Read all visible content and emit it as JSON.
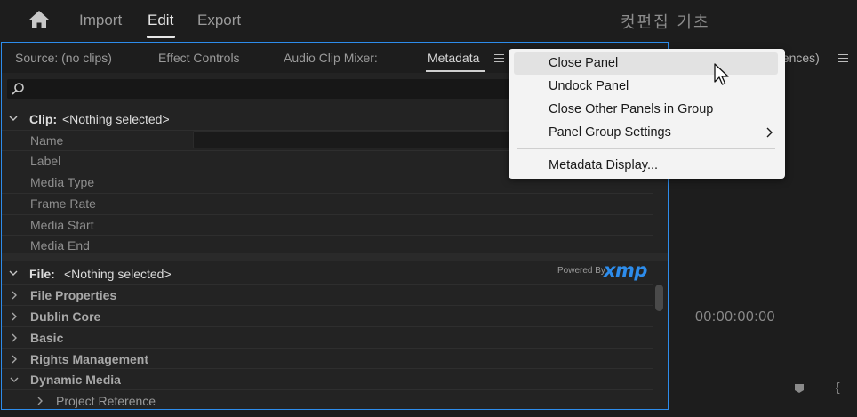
{
  "topbar": {
    "tabs": [
      "Import",
      "Edit",
      "Export"
    ],
    "active_tab": "Edit",
    "project_title": "컷편집 기초"
  },
  "panel_tabs": {
    "source": "Source: (no clips)",
    "effect_controls": "Effect Controls",
    "audio_mixer": "Audio Clip Mixer:",
    "metadata": "Metadata"
  },
  "search": {
    "placeholder": ""
  },
  "clip_section": {
    "label": "Clip:",
    "value": "<Nothing selected>",
    "rows": [
      "Name",
      "Label",
      "Media Type",
      "Frame Rate",
      "Media Start",
      "Media End"
    ]
  },
  "file_section": {
    "label": "File:",
    "value": "<Nothing selected>",
    "powered_by": "Powered By",
    "xmp": "xmp",
    "groups": [
      "File Properties",
      "Dublin Core",
      "Basic",
      "Rights Management",
      "Dynamic Media"
    ],
    "subgroup": "Project Reference"
  },
  "right_panel": {
    "tab_text": "uences)",
    "timecode": "00:00:00:00"
  },
  "context_menu": {
    "items": [
      "Close Panel",
      "Undock Panel",
      "Close Other Panels in Group",
      "Panel Group Settings"
    ],
    "extra": "Metadata Display...",
    "hover_index": 0
  },
  "colors": {
    "accent": "#2d8ceb",
    "panel_bg": "#232323",
    "menu_bg": "#f3f3f3"
  }
}
